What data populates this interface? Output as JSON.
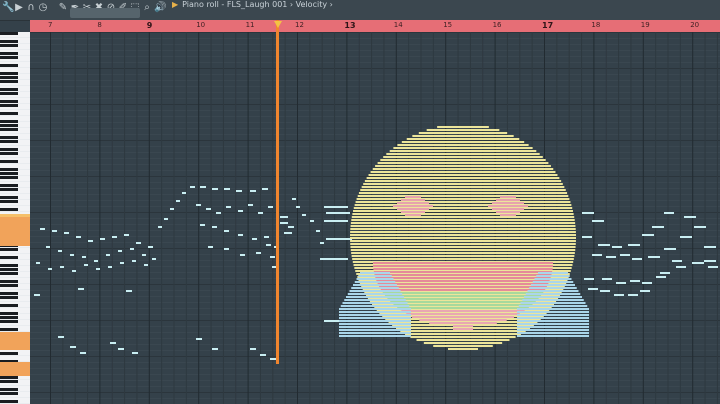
{
  "title": {
    "label": "Piano roll - FLS_Laugh 001 › Velocity ›"
  },
  "toolbar": {
    "icons": [
      "wrench-icon",
      "arrow-icon",
      "magnet-icon",
      "clock-icon",
      "pencil-icon",
      "paintbrush-icon",
      "scissors-icon",
      "delete-icon",
      "mute-icon",
      "slice-icon",
      "select-icon",
      "zoom-icon",
      "speaker-icon",
      "playback-icon"
    ]
  },
  "ruler": {
    "bars": [
      "7",
      "8",
      "9",
      "10",
      "11",
      "12",
      "13",
      "14",
      "15",
      "16",
      "17",
      "18",
      "19",
      "20"
    ],
    "highlighted": [
      "9",
      "13",
      "17"
    ]
  },
  "colors": {
    "background": "#34414a",
    "ruler": "#e66e76",
    "playhead": "#f0852e",
    "note": "#c9eef2",
    "emoji_face": "#ece59a",
    "emoji_tears": "#aad6ea",
    "emoji_mouth_upper": "#e58b99",
    "emoji_mouth_lower": "#a8d99c"
  },
  "notes": [
    [
      40,
      228,
      5
    ],
    [
      52,
      230,
      5
    ],
    [
      64,
      232,
      5
    ],
    [
      76,
      236,
      5
    ],
    [
      88,
      240,
      5
    ],
    [
      100,
      238,
      5
    ],
    [
      112,
      236,
      5
    ],
    [
      124,
      234,
      5
    ],
    [
      136,
      242,
      5
    ],
    [
      148,
      246,
      5
    ],
    [
      46,
      246,
      4
    ],
    [
      58,
      250,
      4
    ],
    [
      70,
      254,
      4
    ],
    [
      82,
      256,
      4
    ],
    [
      94,
      260,
      4
    ],
    [
      106,
      254,
      4
    ],
    [
      118,
      250,
      4
    ],
    [
      130,
      248,
      4
    ],
    [
      142,
      254,
      4
    ],
    [
      152,
      258,
      4
    ],
    [
      36,
      262,
      4
    ],
    [
      48,
      268,
      4
    ],
    [
      60,
      266,
      4
    ],
    [
      72,
      270,
      4
    ],
    [
      84,
      264,
      4
    ],
    [
      96,
      268,
      4
    ],
    [
      108,
      266,
      4
    ],
    [
      120,
      262,
      4
    ],
    [
      132,
      260,
      4
    ],
    [
      144,
      264,
      4
    ],
    [
      158,
      226,
      4
    ],
    [
      164,
      218,
      4
    ],
    [
      170,
      208,
      4
    ],
    [
      176,
      200,
      4
    ],
    [
      182,
      192,
      4
    ],
    [
      190,
      186,
      5
    ],
    [
      200,
      186,
      6
    ],
    [
      212,
      188,
      6
    ],
    [
      224,
      188,
      6
    ],
    [
      236,
      190,
      6
    ],
    [
      250,
      190,
      6
    ],
    [
      262,
      188,
      6
    ],
    [
      196,
      204,
      5
    ],
    [
      206,
      208,
      5
    ],
    [
      216,
      212,
      5
    ],
    [
      226,
      206,
      5
    ],
    [
      238,
      210,
      5
    ],
    [
      248,
      204,
      5
    ],
    [
      258,
      212,
      5
    ],
    [
      268,
      206,
      5
    ],
    [
      200,
      224,
      5
    ],
    [
      212,
      226,
      5
    ],
    [
      224,
      230,
      5
    ],
    [
      238,
      234,
      5
    ],
    [
      252,
      238,
      5
    ],
    [
      264,
      236,
      5
    ],
    [
      208,
      246,
      5
    ],
    [
      224,
      248,
      5
    ],
    [
      240,
      254,
      5
    ],
    [
      256,
      252,
      5
    ],
    [
      266,
      244,
      5
    ],
    [
      280,
      216,
      8
    ],
    [
      280,
      222,
      8
    ],
    [
      288,
      226,
      6
    ],
    [
      284,
      232,
      8
    ],
    [
      292,
      198,
      4
    ],
    [
      296,
      206,
      4
    ],
    [
      302,
      214,
      4
    ],
    [
      310,
      220,
      4
    ],
    [
      316,
      230,
      4
    ],
    [
      320,
      242,
      4
    ],
    [
      270,
      256,
      5
    ],
    [
      272,
      266,
      5
    ],
    [
      274,
      246,
      5
    ],
    [
      324,
      206,
      24
    ],
    [
      326,
      212,
      24
    ],
    [
      326,
      238,
      26
    ],
    [
      320,
      258,
      28
    ],
    [
      324,
      220,
      24
    ],
    [
      58,
      336,
      6
    ],
    [
      70,
      346,
      6
    ],
    [
      80,
      352,
      6
    ],
    [
      110,
      342,
      6
    ],
    [
      118,
      348,
      6
    ],
    [
      132,
      352,
      6
    ],
    [
      196,
      338,
      6
    ],
    [
      212,
      348,
      6
    ],
    [
      250,
      348,
      6
    ],
    [
      260,
      354,
      6
    ],
    [
      270,
      358,
      6
    ],
    [
      78,
      288,
      6
    ],
    [
      126,
      290,
      6
    ],
    [
      34,
      294,
      6
    ],
    [
      324,
      320,
      22
    ],
    [
      582,
      212,
      12
    ],
    [
      592,
      220,
      12
    ],
    [
      582,
      236,
      10
    ],
    [
      598,
      244,
      12
    ],
    [
      612,
      246,
      10
    ],
    [
      628,
      244,
      12
    ],
    [
      642,
      234,
      12
    ],
    [
      652,
      226,
      12
    ],
    [
      664,
      212,
      10
    ],
    [
      684,
      216,
      12
    ],
    [
      592,
      254,
      10
    ],
    [
      606,
      256,
      10
    ],
    [
      620,
      254,
      10
    ],
    [
      632,
      258,
      10
    ],
    [
      648,
      256,
      12
    ],
    [
      664,
      248,
      12
    ],
    [
      680,
      236,
      12
    ],
    [
      694,
      226,
      12
    ],
    [
      704,
      246,
      12
    ],
    [
      584,
      278,
      10
    ],
    [
      602,
      278,
      10
    ],
    [
      616,
      282,
      10
    ],
    [
      630,
      280,
      10
    ],
    [
      642,
      282,
      10
    ],
    [
      660,
      272,
      10
    ],
    [
      676,
      266,
      10
    ],
    [
      692,
      262,
      12
    ],
    [
      708,
      266,
      10
    ],
    [
      588,
      288,
      10
    ],
    [
      600,
      290,
      10
    ],
    [
      614,
      294,
      10
    ],
    [
      628,
      294,
      10
    ],
    [
      640,
      290,
      10
    ],
    [
      656,
      276,
      10
    ],
    [
      672,
      260,
      10
    ],
    [
      704,
      260,
      12
    ]
  ]
}
